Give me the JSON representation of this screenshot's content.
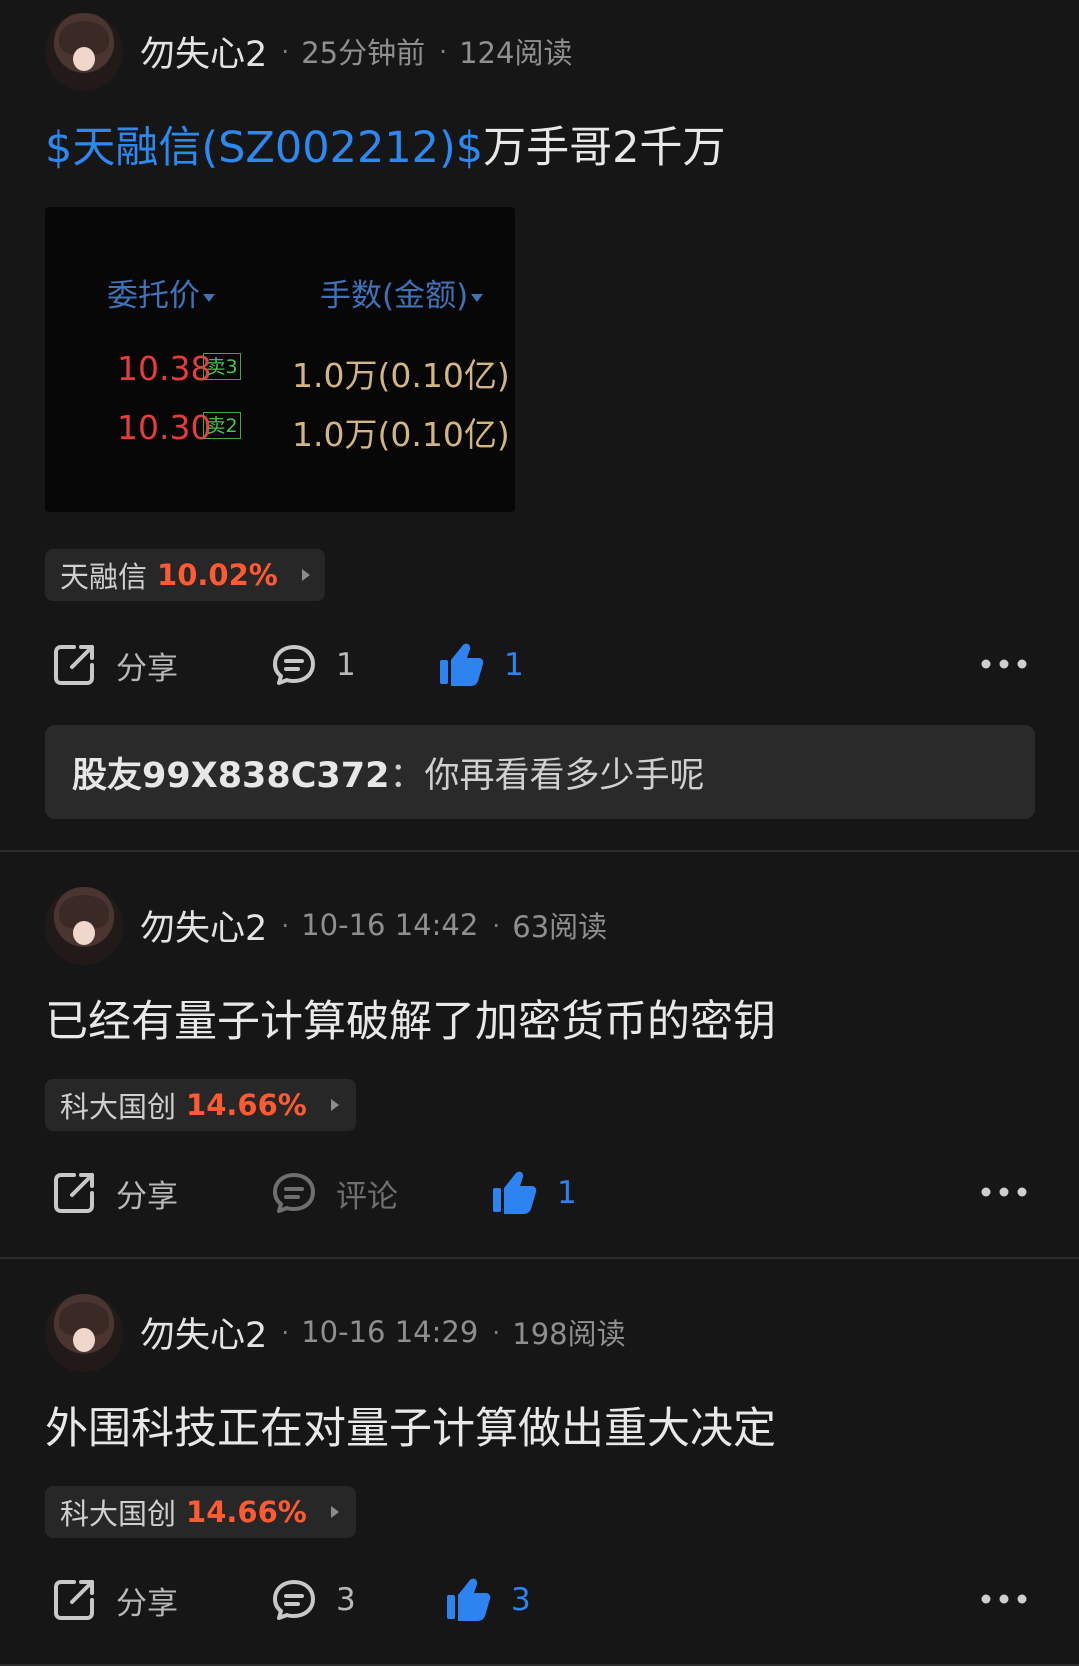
{
  "colors": {
    "background": "#161616",
    "accent_blue": "#2c89f2",
    "gain_orange": "#ff5a32",
    "sell_red": "#e63c3c",
    "sell_tag_green": "#48c34e",
    "amount_gold": "#d2b583"
  },
  "posts": [
    {
      "username": "勿失心2",
      "separator": "·",
      "time": "25分钟前",
      "reads": "124阅读",
      "text": {
        "stock_link": "$天融信(SZ002212)$",
        "body": "万手哥2千万"
      },
      "order_book": {
        "price_header": "委托价",
        "quantity_header": "手数(金额)",
        "rows": [
          {
            "price": "10.38",
            "level": "卖3",
            "amount": "1.0万(0.10亿)"
          },
          {
            "price": "10.30",
            "level": "卖2",
            "amount": "1.0万(0.10亿)"
          }
        ]
      },
      "quote": {
        "name": "天融信",
        "change": "10.02%"
      },
      "actions": {
        "share_label": "分享",
        "comment_label": "1",
        "like_count": "1",
        "share_icon": "share-icon",
        "comment_icon": "comment-icon",
        "like_icon": "thumbs-up-icon",
        "more_icon": "more-icon"
      },
      "comment_preview": {
        "user": "股友99X838C372",
        "separator": "：",
        "text": "你再看看多少手呢"
      }
    },
    {
      "username": "勿失心2",
      "separator": "·",
      "time": "10-16 14:42",
      "reads": "63阅读",
      "text": {
        "body": "已经有量子计算破解了加密货币的密钥"
      },
      "quote": {
        "name": "科大国创",
        "change": "14.66%"
      },
      "actions": {
        "share_label": "分享",
        "comment_label": "评论",
        "like_count": "1",
        "share_icon": "share-icon",
        "comment_icon": "comment-icon",
        "like_icon": "thumbs-up-icon",
        "more_icon": "more-icon"
      }
    },
    {
      "username": "勿失心2",
      "separator": "·",
      "time": "10-16 14:29",
      "reads": "198阅读",
      "text": {
        "body": "外围科技正在对量子计算做出重大决定"
      },
      "quote": {
        "name": "科大国创",
        "change": "14.66%"
      },
      "actions": {
        "share_label": "分享",
        "comment_label": "3",
        "like_count": "3",
        "share_icon": "share-icon",
        "comment_icon": "comment-icon",
        "like_icon": "thumbs-up-icon",
        "more_icon": "more-icon"
      }
    }
  ]
}
